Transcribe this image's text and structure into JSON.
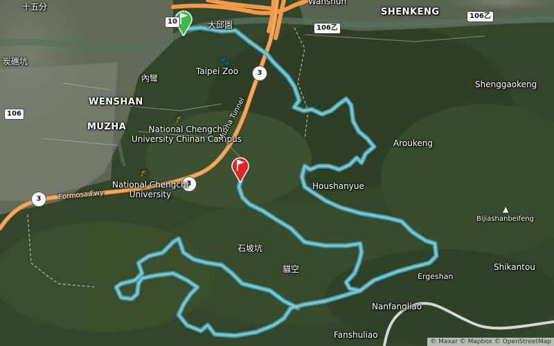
{
  "map": {
    "colors": {
      "route": "#5fb7c8",
      "motorway": "#f29a4a",
      "start_flag": "#3dba4e",
      "end_flag": "#e2232b",
      "boundary": "#cfd6d8"
    },
    "start_marker_icon": "start-flag-icon",
    "end_marker_icon": "end-flag-icon"
  },
  "places": {
    "shiwufen": "十五分",
    "tanliaokeng": "炭礁坑",
    "wenshan": "WENSHAN",
    "muzha": "MUZHA",
    "neiwan": "內彎",
    "dakuyuan": "大邱園",
    "taipei_zoo": "Taipei Zoo",
    "nccu_chinan_line1": "National Chengchi",
    "nccu_chinan_line2": "University Chinan Campus",
    "nccu_line1": "National Chengchi",
    "nccu_line2": "University",
    "wanshun": "Wanshun",
    "shenkeng": "SHENKENG",
    "shenggaokeng": "Shenggaokeng",
    "aroukeng": "Aroukeng",
    "houshanyue": "Houshanyue",
    "bijiashanbeifeng": "Bijiashanbeifeng",
    "shikantou": "Shikantou",
    "ergeshan": "Ergeshan",
    "nanfangliao": "Nanfangliao",
    "fanshuliao": "Fanshuliao",
    "shipokeng": "石坡坑",
    "maokong": "貓空",
    "muzha_tunnel": "Muzha Tunnel",
    "formosa_fwy": "Formosa Fwy"
  },
  "shields": {
    "r106_west": "106",
    "r106_north": "106乙",
    "r106_east": "106乙",
    "r10": "10",
    "fwy3_zoo": "3",
    "fwy3_nccu": "3",
    "fwy3_west": "3"
  },
  "attribution": "© Maxar © Mapbox © OpenStreetMap"
}
